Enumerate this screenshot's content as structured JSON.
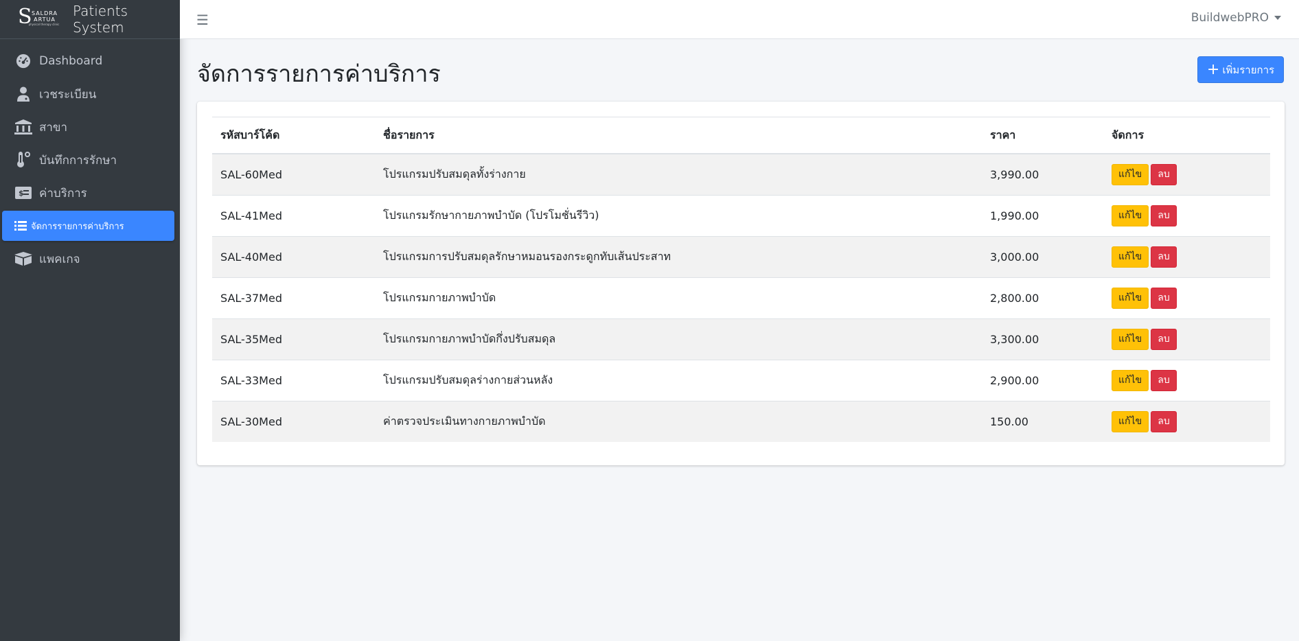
{
  "brand": {
    "logo_line1": "SALDRA",
    "logo_line2": "ARTUA",
    "logo_line3": "physical therapy clinic",
    "name": "Patients System"
  },
  "sidebar": {
    "items": [
      {
        "label": "Dashboard",
        "icon": "dashboard-gauge-icon"
      },
      {
        "label": "เวชระเบียน",
        "icon": "user-doctor-icon"
      },
      {
        "label": "สาขา",
        "icon": "building-icon"
      },
      {
        "label": "บันทึกการรักษา",
        "icon": "thermometer-icon"
      },
      {
        "label": "ค่าบริการ",
        "icon": "money-bill-icon"
      },
      {
        "label": "จัดการรายการค่าบริการ",
        "icon": "list-icon",
        "active": true
      },
      {
        "label": "แพคเกจ",
        "icon": "boxes-icon"
      }
    ],
    "active_color": "#3a86ff"
  },
  "topbar": {
    "menu_icon": "hamburger-icon",
    "user": "BuildwebPRO"
  },
  "page": {
    "title": "จัดการรายการค่าบริการ",
    "add_button": "เพิ่มรายการ"
  },
  "table": {
    "headers": [
      "รหัสบาร์โค้ด",
      "ชื่อรายการ",
      "ราคา",
      "จัดการ"
    ],
    "rows": [
      {
        "code": "SAL-60Med",
        "name": "โปรแกรมปรับสมดุลทั้งร่างกาย",
        "price": "3,990.00"
      },
      {
        "code": "SAL-41Med",
        "name": "โปรแกรมรักษากายภาพบำบัด (โปรโมชั่นรีวิว)",
        "price": "1,990.00"
      },
      {
        "code": "SAL-40Med",
        "name": "โปรแกรมการปรับสมดุลรักษาหมอนรองกระดูกทับเส้นประสาท",
        "price": "3,000.00"
      },
      {
        "code": "SAL-37Med",
        "name": "โปรแกรมกายภาพบำบัด",
        "price": "2,800.00"
      },
      {
        "code": "SAL-35Med",
        "name": "โปรแกรมกายภาพบำบัดกึ่งปรับสมดุล",
        "price": "3,300.00"
      },
      {
        "code": "SAL-33Med",
        "name": "โปรแกรมปรับสมดุลร่างกายส่วนหลัง",
        "price": "2,900.00"
      },
      {
        "code": "SAL-30Med",
        "name": "ค่าตรวจประเมินทางกายภาพบำบัด",
        "price": "150.00"
      }
    ],
    "edit_label": "แก้ไข",
    "delete_label": "ลบ"
  }
}
